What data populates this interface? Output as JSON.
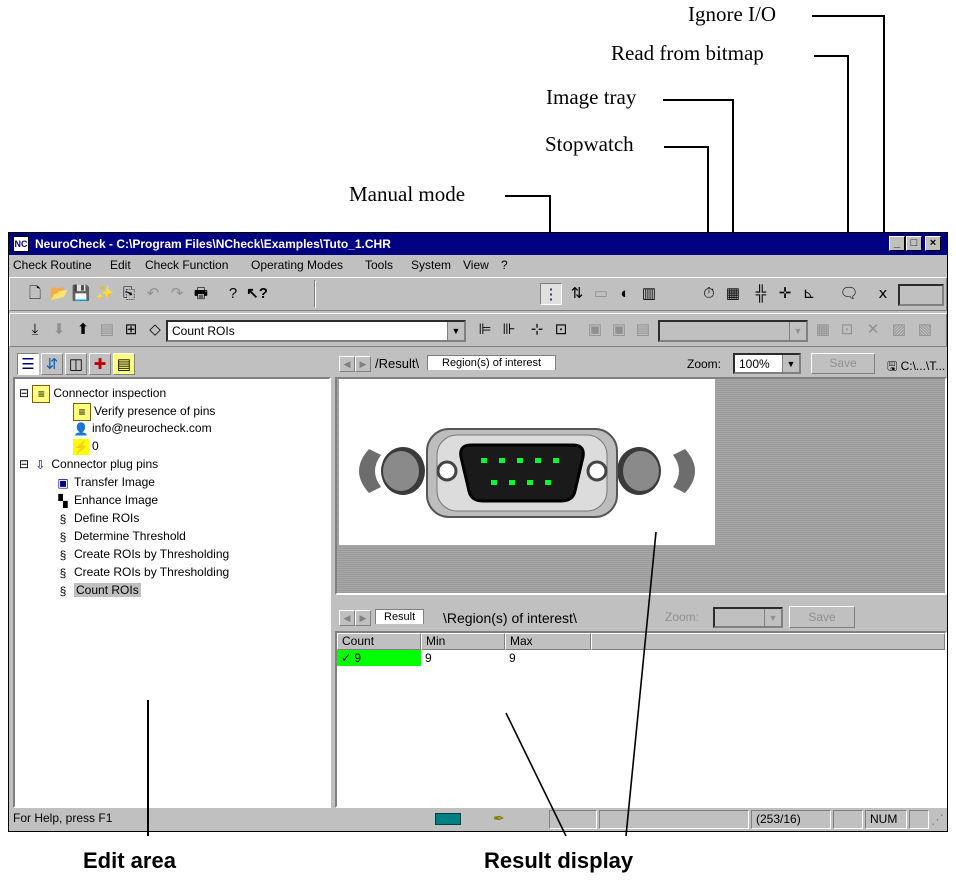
{
  "callouts": {
    "ignore_io": "Ignore I/O",
    "read_from_bitmap": "Read from bitmap",
    "image_tray": "Image tray",
    "stopwatch": "Stopwatch",
    "manual_mode": "Manual mode",
    "edit_area": "Edit area",
    "result_display": "Result display"
  },
  "window": {
    "title": "NeuroCheck - C:\\Program Files\\NCheck\\Examples\\Tuto_1.CHR",
    "app_icon": "NC"
  },
  "menu": [
    "Check Routine",
    "Edit",
    "Check Function",
    "Operating Modes",
    "Tools",
    "System",
    "View",
    "?"
  ],
  "toolbar2": {
    "function_select": "Count ROIs"
  },
  "tree": {
    "items": [
      {
        "label": "Connector inspection",
        "icon": "routine-icon"
      },
      {
        "label": "Verify presence of pins",
        "icon": "note-icon"
      },
      {
        "label": "info@neurocheck.com",
        "icon": "person-icon"
      },
      {
        "label": "0",
        "icon": "warning-icon"
      },
      {
        "label": "Connector plug pins",
        "icon": "check-icon"
      },
      {
        "label": "Transfer Image",
        "icon": "camera-icon"
      },
      {
        "label": "Enhance Image",
        "icon": "enhance-icon"
      },
      {
        "label": "Define ROIs",
        "icon": "roi-icon"
      },
      {
        "label": "Determine Threshold",
        "icon": "roi-icon"
      },
      {
        "label": "Create ROIs by Thresholding",
        "icon": "roi-icon"
      },
      {
        "label": "Create ROIs by Thresholding",
        "icon": "roi-icon"
      },
      {
        "label": "Count ROIs",
        "icon": "roi-icon"
      }
    ]
  },
  "image_view": {
    "tab_result": "Result",
    "tab_roi": "Region(s) of interest",
    "zoom_label": "Zoom:",
    "zoom_value": "100%",
    "save": "Save",
    "path": "C:\\...\\T..."
  },
  "result_view": {
    "tab_result": "Result",
    "tab_roi": "Region(s) of interest",
    "zoom_label": "Zoom:",
    "save": "Save",
    "columns": [
      "Count",
      "Min",
      "Max"
    ],
    "row": {
      "count": "9",
      "min": "9",
      "max": "9",
      "status": "ok"
    },
    "ok_color": "#00ff00"
  },
  "statusbar": {
    "help": "For Help, press F1",
    "coords": "(253/16)",
    "num": "NUM"
  }
}
